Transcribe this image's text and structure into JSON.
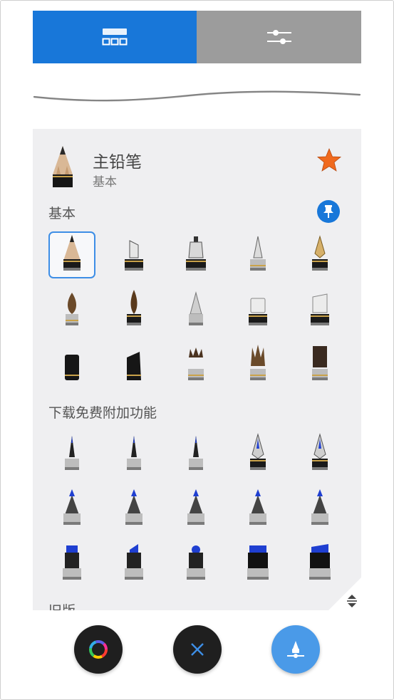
{
  "tabs": [
    {
      "name": "brush-library",
      "icon": "library-grid-icon",
      "active": true,
      "color": "#1877d9"
    },
    {
      "name": "brush-settings",
      "icon": "sliders-icon",
      "active": false,
      "color": "#9c9c9c"
    }
  ],
  "current_brush": {
    "name": "主铅笔",
    "category": "基本",
    "icon": "pencil-icon",
    "favorite": true,
    "favorite_color": "#f06a1e"
  },
  "sections": [
    {
      "label": "基本",
      "pinned": true,
      "brushes": [
        {
          "icon": "pencil-icon",
          "selected": true
        },
        {
          "icon": "chisel-marker-icon",
          "selected": false
        },
        {
          "icon": "technical-pen-icon",
          "selected": false
        },
        {
          "icon": "ballpoint-pen-icon",
          "selected": false
        },
        {
          "icon": "fountain-pen-icon",
          "selected": false
        },
        {
          "icon": "round-brush-icon",
          "selected": false
        },
        {
          "icon": "ink-brush-icon",
          "selected": false
        },
        {
          "icon": "airbrush-icon",
          "selected": false
        },
        {
          "icon": "eraser-icon",
          "selected": false
        },
        {
          "icon": "hard-eraser-icon",
          "selected": false
        },
        {
          "icon": "felt-marker-icon",
          "selected": false
        },
        {
          "icon": "chisel-felt-icon",
          "selected": false
        },
        {
          "icon": "flat-bristle-brush-icon",
          "selected": false
        },
        {
          "icon": "fan-bristle-brush-icon",
          "selected": false
        },
        {
          "icon": "dark-bristle-brush-icon",
          "selected": false
        }
      ]
    },
    {
      "label": "下载免费附加功能",
      "pinned": false,
      "brushes": [
        {
          "icon": "fineliner-icon"
        },
        {
          "icon": "fineliner-medium-icon"
        },
        {
          "icon": "fineliner-broad-icon"
        },
        {
          "icon": "dip-pen-icon"
        },
        {
          "icon": "dip-pen-wide-icon"
        },
        {
          "icon": "cone-marker-icon"
        },
        {
          "icon": "cone-marker-medium-icon"
        },
        {
          "icon": "cone-marker-broad-icon"
        },
        {
          "icon": "bullet-marker-icon"
        },
        {
          "icon": "bullet-marker-dark-icon"
        },
        {
          "icon": "chisel-marker-blue-icon"
        },
        {
          "icon": "angled-marker-icon"
        },
        {
          "icon": "round-marker-icon"
        },
        {
          "icon": "wide-marker-icon"
        },
        {
          "icon": "slant-wide-marker-icon"
        }
      ]
    },
    {
      "label": "旧版",
      "pinned": false,
      "brushes": []
    }
  ],
  "bottom_bar": {
    "color_button_icon": "color-wheel-icon",
    "close_button_icon": "close-icon",
    "brush_button_icon": "brush-tool-icon",
    "close_color": "#3d8ee6",
    "brush_button_color": "#4a9ae8"
  }
}
